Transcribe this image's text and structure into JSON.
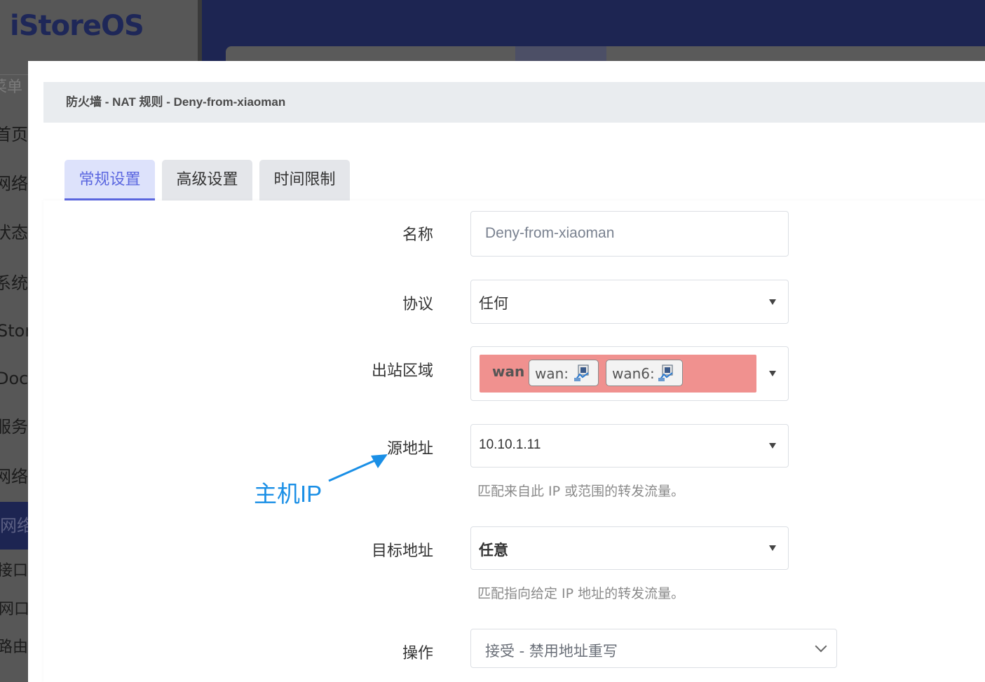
{
  "app": {
    "logo": "iStoreOS"
  },
  "sidebar": {
    "search_placeholder": "菜单",
    "items": [
      {
        "label": "首页"
      },
      {
        "label": "网络"
      },
      {
        "label": "状态"
      },
      {
        "label": "系统"
      },
      {
        "label": "Store"
      },
      {
        "label": "Docker"
      },
      {
        "label": "服务"
      },
      {
        "label": "网络"
      },
      {
        "label": "网络",
        "active": true
      },
      {
        "label": "接口"
      },
      {
        "label": "网口配置"
      },
      {
        "label": "路由"
      }
    ]
  },
  "modal": {
    "title": "防火墙 - NAT 规则 - Deny-from-xiaoman",
    "tabs": [
      {
        "label": "常规设置",
        "active": true
      },
      {
        "label": "高级设置"
      },
      {
        "label": "时间限制"
      }
    ],
    "form": {
      "name": {
        "label": "名称",
        "value": "Deny-from-xiaoman"
      },
      "protocol": {
        "label": "协议",
        "value": "任何"
      },
      "outbound_zone": {
        "label": "出站区域",
        "zone": "wan",
        "interfaces": [
          "wan:",
          "wan6:"
        ],
        "zone_color": "#f0918f"
      },
      "source": {
        "label": "源地址",
        "value": "10.10.1.11",
        "hint": "匹配来自此 IP 或范围的转发流量。"
      },
      "destination": {
        "label": "目标地址",
        "value": "任意",
        "hint": "匹配指向给定 IP 地址的转发流量。"
      },
      "action": {
        "label": "操作",
        "value": "接受 - 禁用地址重写"
      }
    },
    "annotation": {
      "text": "主机IP",
      "color": "#1a8fe6"
    }
  },
  "colors": {
    "accent": "#5b67e0",
    "header": "#1d2552"
  }
}
